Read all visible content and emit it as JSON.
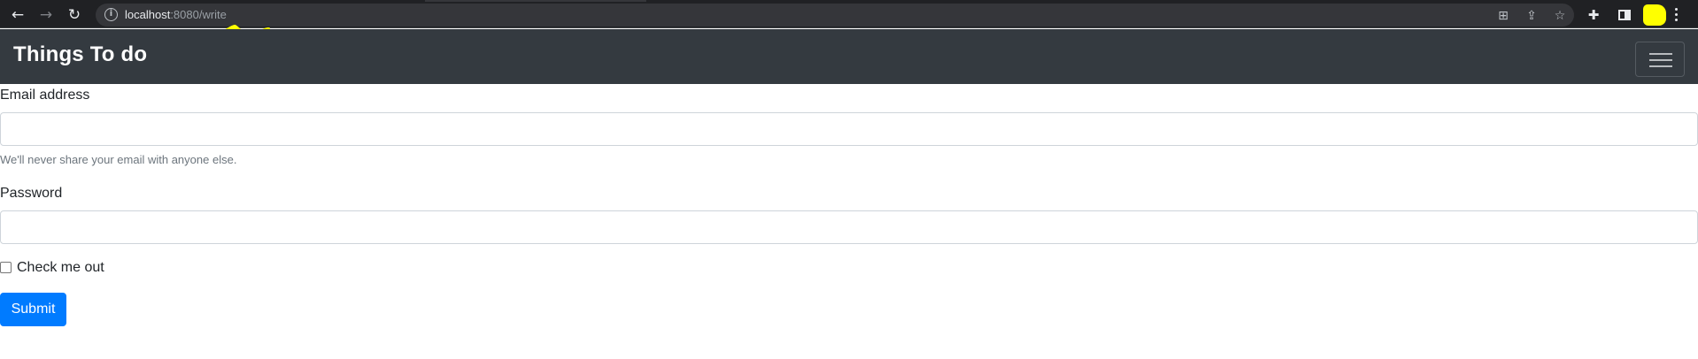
{
  "browser": {
    "url_host": "localhost",
    "url_path": ":8080/write",
    "icons": {
      "back": "←",
      "forward": "→",
      "reload": "↻",
      "info": "i",
      "translate": "⊞",
      "share": "⇪",
      "bookmark": "☆",
      "extensions": "✚"
    },
    "accent": "#ffff00"
  },
  "navbar": {
    "brand": "Things To do",
    "background": "#343a40"
  },
  "form": {
    "email_label": "Email address",
    "email_value": "",
    "email_help": "We'll never share your email with anyone else.",
    "password_label": "Password",
    "password_value": "",
    "checkbox_label": "Check me out",
    "checkbox_checked": false,
    "submit_label": "Submit",
    "submit_color": "#007bff"
  }
}
